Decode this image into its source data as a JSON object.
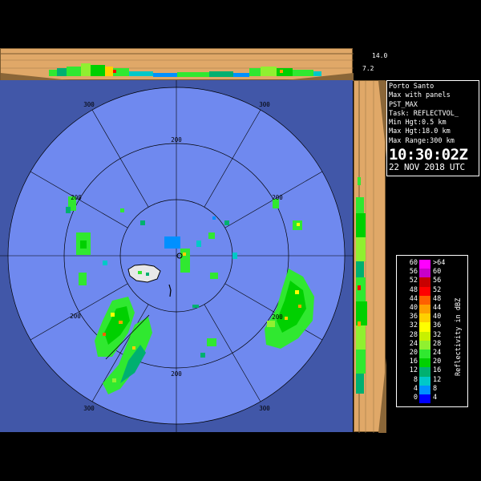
{
  "radar": {
    "station": "Porto Santo",
    "product": "Max with panels",
    "product_code": "PST_MAX",
    "task": "Task: REFLECTVOL_",
    "min_height": "Min Hgt:0.5 km",
    "max_height": "Max Hgt:18.0 km",
    "max_range": "Max Range:300 km",
    "time": "10:30:02Z",
    "date": "22 NOV 2018 UTC"
  },
  "panels": {
    "height_top": "14.0",
    "height_bottom": "7.2"
  },
  "range_rings": {
    "labels": [
      "300",
      "200",
      "200",
      "300",
      "200",
      "200",
      "200",
      "200",
      "300",
      "300"
    ],
    "units": "km"
  },
  "legend": {
    "title": "Reflectivity in dBZ",
    "left_scale": [
      "60",
      "56",
      "52",
      "48",
      "44",
      "40",
      "36",
      "32",
      "28",
      "24",
      "20",
      "16",
      "12",
      "8",
      "4",
      "0"
    ],
    "right_scale": [
      ">64",
      "60",
      "56",
      "52",
      "48",
      "44",
      "40",
      "36",
      "32",
      "28",
      "24",
      "20",
      "16",
      "12",
      "8",
      "4"
    ],
    "colors": [
      "#0000FF",
      "#0090FF",
      "#00C8C8",
      "#00B070",
      "#00D000",
      "#30E830",
      "#90F030",
      "#C8F000",
      "#FFFF00",
      "#FFD000",
      "#FFA000",
      "#FF6000",
      "#FF0000",
      "#C80000",
      "#C800C8",
      "#FF00FF"
    ]
  },
  "colors": {
    "background": "#000000",
    "ppi_outside": "#4157A8",
    "ppi_inside": "#6F89EF",
    "panel_bg": "#E0A868"
  }
}
